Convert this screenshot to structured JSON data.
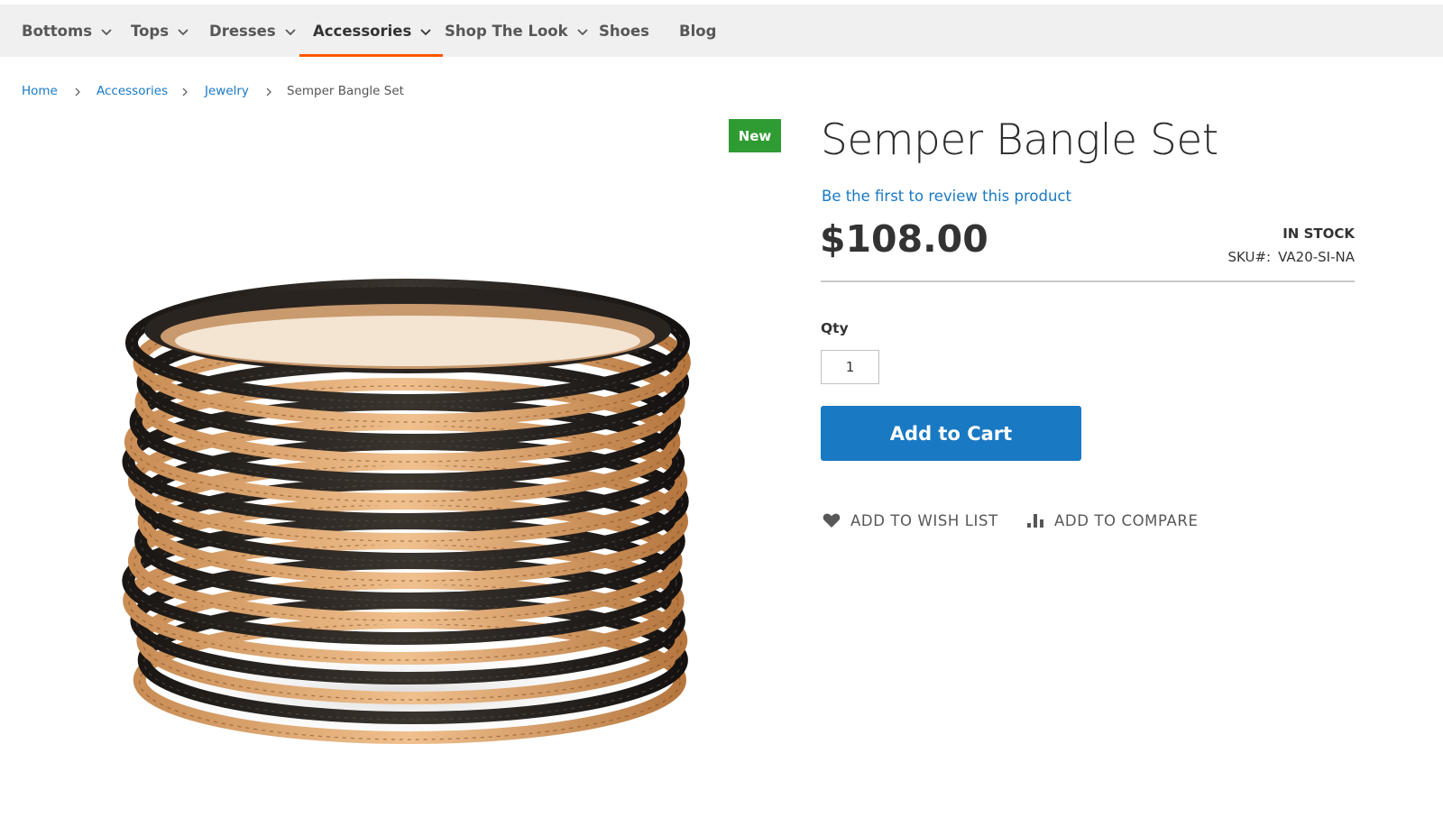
{
  "nav": {
    "items": [
      {
        "label": "Bottoms",
        "has_dropdown": true,
        "active": false
      },
      {
        "label": "Tops",
        "has_dropdown": true,
        "active": false
      },
      {
        "label": "Dresses",
        "has_dropdown": true,
        "active": false
      },
      {
        "label": "Accessories",
        "has_dropdown": true,
        "active": true
      },
      {
        "label": "Shop The Look",
        "has_dropdown": true,
        "active": false
      },
      {
        "label": "Shoes",
        "has_dropdown": false,
        "active": false
      },
      {
        "label": "Blog",
        "has_dropdown": false,
        "active": false
      }
    ],
    "active_color": "#ff5501"
  },
  "breadcrumbs": [
    {
      "label": "Home",
      "link": true
    },
    {
      "label": "Accessories",
      "link": true
    },
    {
      "label": "Jewelry",
      "link": true
    },
    {
      "label": "Semper Bangle Set",
      "link": false
    }
  ],
  "product": {
    "badge": "New",
    "title": "Semper Bangle Set",
    "review_link": "Be the first to review this product",
    "price": "$108.00",
    "stock_status": "IN STOCK",
    "sku_label": "SKU#:",
    "sku_value": "VA20-SI-NA",
    "qty_label": "Qty",
    "qty_value": "1",
    "add_to_cart_label": "Add to Cart",
    "wishlist_label": "ADD TO WISH LIST",
    "compare_label": "ADD TO COMPARE",
    "image_icon": "bangle-stack-image"
  },
  "colors": {
    "link": "#1979c3",
    "primary_button": "#1979c3",
    "badge_new": "#2f9c33"
  }
}
